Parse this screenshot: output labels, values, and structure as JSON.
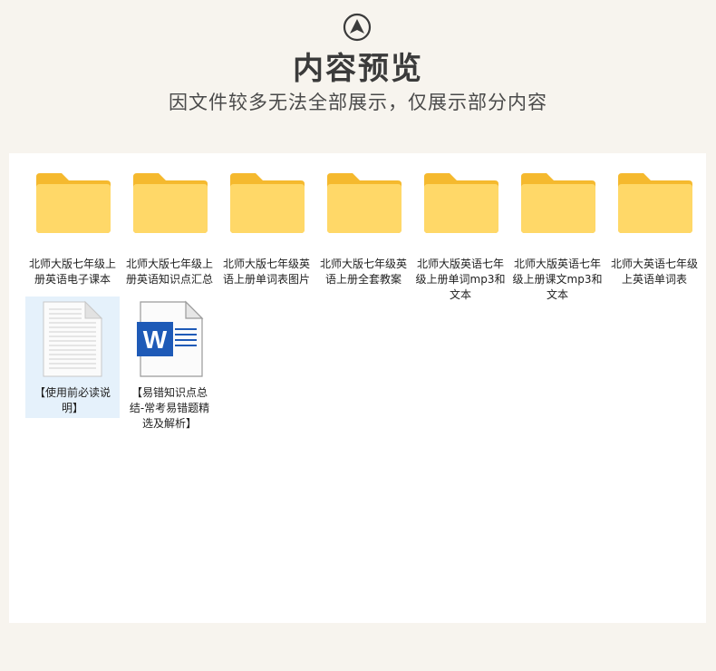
{
  "header": {
    "title": "内容预览",
    "subtitle": "因文件较多无法全部展示，仅展示部分内容",
    "logo_icon": "navigation-arrow-icon"
  },
  "colors": {
    "background": "#f7f4ee",
    "panel": "#ffffff",
    "folder_back": "#f5b92e",
    "folder_front": "#ffd868",
    "selection": "#e5f1fb",
    "word_blue": "#1e5ab7"
  },
  "files": [
    {
      "label": "北师大版七年级上册英语电子课本",
      "type": "folder",
      "icon": "folder-icon"
    },
    {
      "label": "北师大版七年级上册英语知识点汇总",
      "type": "folder",
      "icon": "folder-icon"
    },
    {
      "label": "北师大版七年级英语上册单词表图片",
      "type": "folder",
      "icon": "folder-icon"
    },
    {
      "label": "北师大版七年级英语上册全套教案",
      "type": "folder",
      "icon": "folder-icon"
    },
    {
      "label": "北师大版英语七年级上册单词mp3和文本",
      "type": "folder",
      "icon": "folder-icon"
    },
    {
      "label": "北师大版英语七年级上册课文mp3和文本",
      "type": "folder",
      "icon": "folder-icon"
    },
    {
      "label": "北师大英语七年级上英语单词表",
      "type": "folder",
      "icon": "folder-icon"
    },
    {
      "label": "【使用前必读说明】",
      "type": "text",
      "icon": "text-document-icon",
      "selected": true
    },
    {
      "label": "【易错知识点总结-常考易错题精选及解析】",
      "type": "word",
      "icon": "word-document-icon"
    }
  ]
}
